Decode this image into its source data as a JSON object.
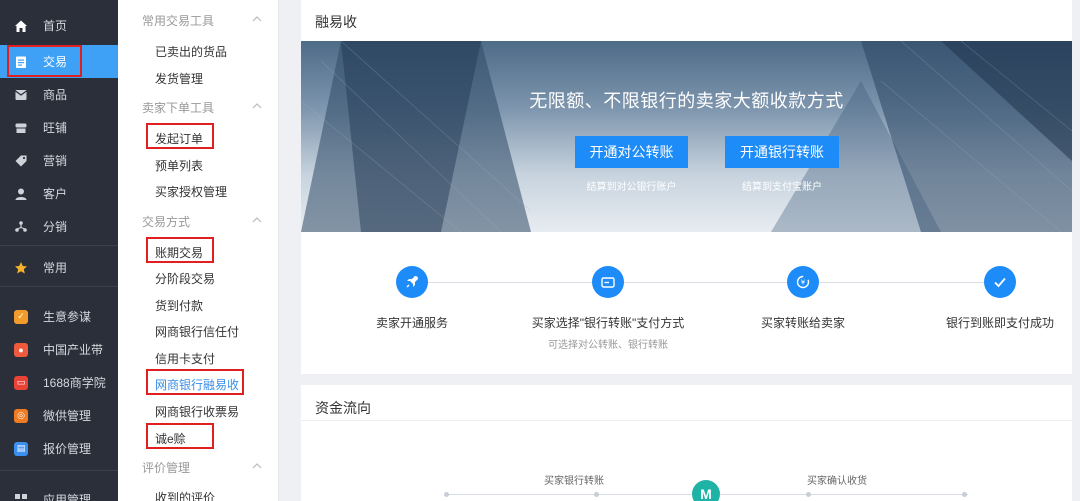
{
  "nav": {
    "items": [
      {
        "label": "首页",
        "icon": "home-icon"
      },
      {
        "label": "交易",
        "icon": "clipboard-icon"
      },
      {
        "label": "商品",
        "icon": "box-icon"
      },
      {
        "label": "旺铺",
        "icon": "store-icon"
      },
      {
        "label": "营销",
        "icon": "tag-icon"
      },
      {
        "label": "客户",
        "icon": "user-icon"
      },
      {
        "label": "分销",
        "icon": "share-icon"
      },
      {
        "label": "常用",
        "icon": "star-icon"
      },
      {
        "label": "生意参谋",
        "icon": "chart-app-icon"
      },
      {
        "label": "中国产业带",
        "icon": "location-app-icon"
      },
      {
        "label": "1688商学院",
        "icon": "school-app-icon"
      },
      {
        "label": "微供管理",
        "icon": "weigong-app-icon"
      },
      {
        "label": "报价管理",
        "icon": "quote-app-icon"
      },
      {
        "label": "应用管理",
        "icon": "apps-grid-icon"
      }
    ]
  },
  "sub": {
    "groups": [
      {
        "title": "常用交易工具",
        "links": [
          "已卖出的货品",
          "发货管理"
        ]
      },
      {
        "title": "卖家下单工具",
        "links": [
          "发起订单",
          "预单列表",
          "买家授权管理"
        ]
      },
      {
        "title": "交易方式",
        "links": [
          "账期交易",
          "分阶段交易",
          "货到付款",
          "网商银行信任付",
          "信用卡支付",
          "网商银行融易收",
          "网商银行收票易",
          "诚e赊"
        ]
      },
      {
        "title": "评价管理",
        "links": [
          "收到的评价"
        ]
      }
    ]
  },
  "main": {
    "title": "融易收",
    "banner": {
      "headline": "无限额、不限银行的卖家大额收款方式",
      "btn1": "开通对公转账",
      "btn1_sub": "结算到对公银行账户",
      "btn2": "开通银行转账",
      "btn2_sub": "结算到支付宝账户"
    },
    "steps": [
      {
        "label": "卖家开通服务",
        "sub": ""
      },
      {
        "label": "买家选择\"银行转账\"支付方式",
        "sub": "可选择对公转账、银行转账"
      },
      {
        "label": "买家转账给卖家",
        "sub": ""
      },
      {
        "label": "银行到账即支付成功",
        "sub": ""
      }
    ],
    "flow": {
      "title": "资金流向",
      "label1": "买家银行转账",
      "label2": "买家确认收货",
      "logo_text": "M"
    }
  },
  "colors": {
    "accent": "#1d8cf8",
    "nav_bg": "#2b2f3a",
    "nav_active": "#3ea1f5",
    "highlight": "#e02020"
  }
}
